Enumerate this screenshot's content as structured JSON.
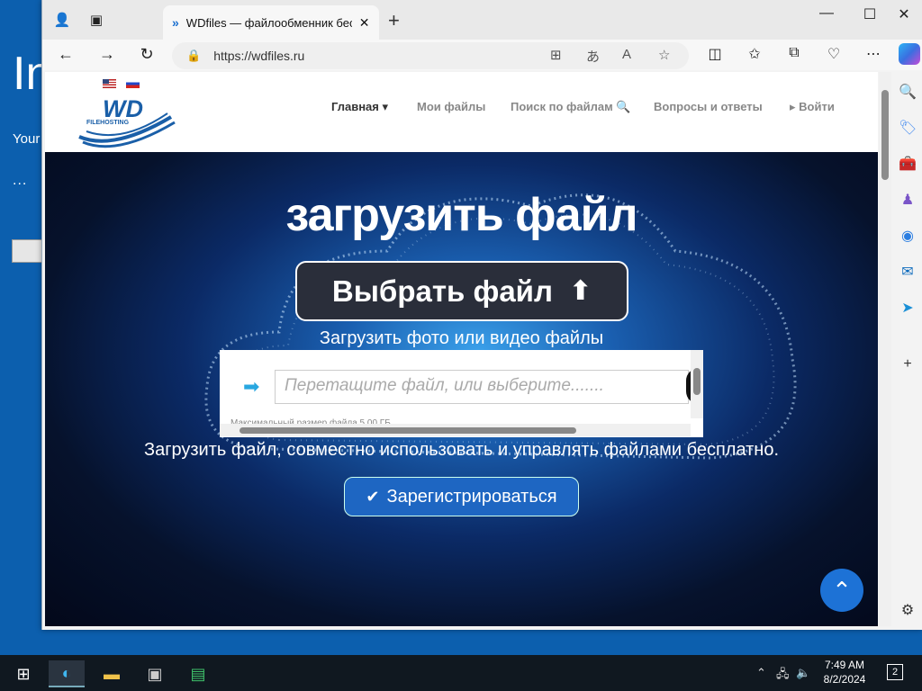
{
  "desktop": {
    "title": "In",
    "subtitle": "Your",
    "dots": "..."
  },
  "browser": {
    "tab_title": "WDfiles — файлообменник бес",
    "url": "https://wdfiles.ru"
  },
  "site": {
    "logo_text": "WD",
    "logo_sub": "FILEHOSTING",
    "nav": [
      {
        "label": "Главная ▾"
      },
      {
        "label": "Мои файлы"
      },
      {
        "label": "Поиск по файлам 🔍"
      },
      {
        "label": "Вопросы и ответы"
      },
      {
        "label": "▸ Войти"
      }
    ]
  },
  "hero": {
    "title": "загрузить файл",
    "choose_label": "Выбрать файл",
    "upload_hint": "Загрузить фото или видео файлы",
    "drop_placeholder": "Перетащите файл, или выберите.......",
    "max_size": "Максимальный размер файла 5.00 ГБ",
    "tagline": "Загрузить файл, совместно использовать и управлять файлами бесплатно.",
    "register_label": "Зарегистрироваться"
  },
  "taskbar": {
    "time": "7:49 AM",
    "date": "8/2/2024",
    "notifications": "2"
  }
}
